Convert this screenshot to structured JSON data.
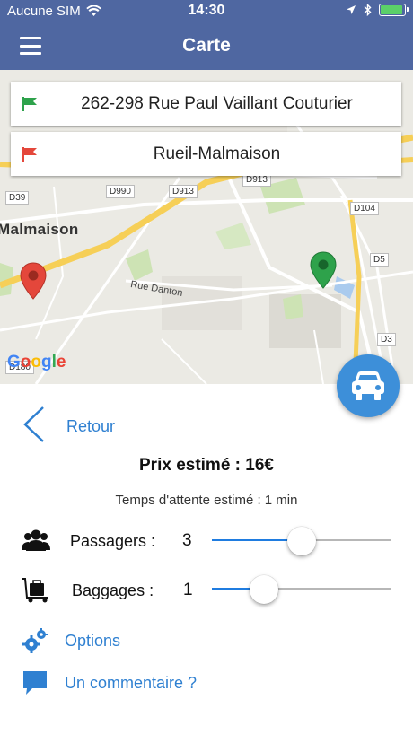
{
  "status_bar": {
    "carrier": "Aucune SIM",
    "time": "14:30"
  },
  "nav": {
    "title": "Carte"
  },
  "map": {
    "from_address": "262-298 Rue Paul Vaillant Couturier",
    "to_address": "Rueil-Malmaison",
    "place_label": "Malmaison",
    "street_label": "Rue Danton",
    "road_labels": [
      "D39",
      "D990",
      "D913",
      "D913",
      "D104",
      "D5",
      "D3",
      "D180"
    ],
    "logo": "Google",
    "colors": {
      "from_flag": "#2ea24b",
      "to_flag": "#e4473b",
      "origin_pin": "#e4473b",
      "destination_pin": "#2ea24b"
    }
  },
  "booking": {
    "back_label": "Retour",
    "price": "Prix estimé : 16€",
    "wait": "Temps d'attente estimé : 1 min",
    "passengers": {
      "label": "Passagers :",
      "value": "3"
    },
    "luggage": {
      "label": "Baggages :",
      "value": "1"
    },
    "options_label": "Options",
    "comment_label": "Un commentaire ?"
  },
  "accent_color": "#2f80d1",
  "header_color": "#4f67a1"
}
